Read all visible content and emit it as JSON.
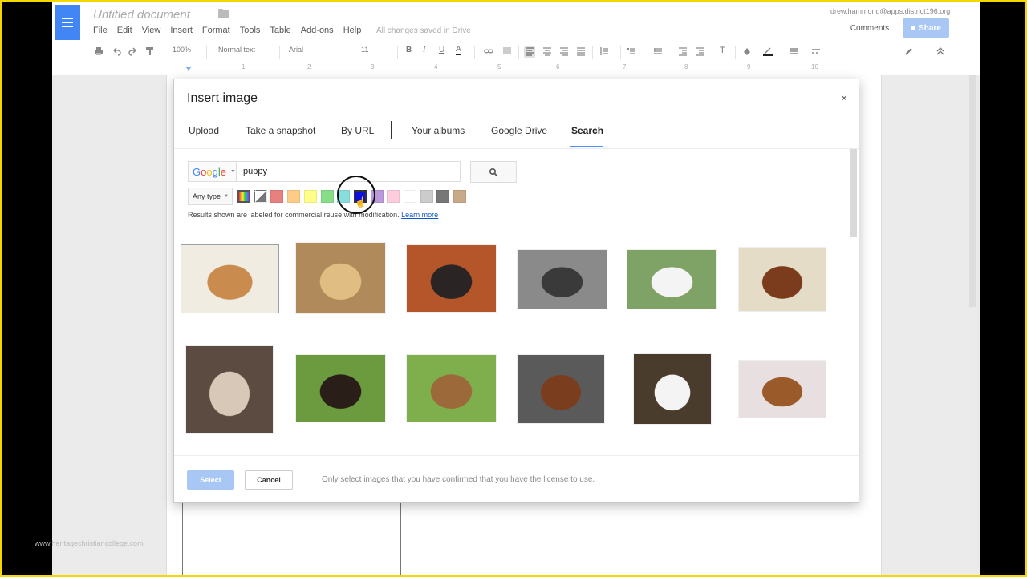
{
  "app": {
    "doc_title": "Untitled document",
    "user_email": "drew.hammond@apps.district196.org",
    "comments_label": "Comments",
    "share_label": "Share",
    "saved_status": "All changes saved in Drive"
  },
  "menu": [
    "File",
    "Edit",
    "View",
    "Insert",
    "Format",
    "Tools",
    "Table",
    "Add-ons",
    "Help"
  ],
  "toolbar": {
    "zoom": "100%",
    "style": "Normal text",
    "font": "Arial",
    "size": "11"
  },
  "ruler": [
    "1",
    "2",
    "3",
    "4",
    "5",
    "6",
    "7",
    "8",
    "9",
    "10"
  ],
  "dialog": {
    "title": "Insert image",
    "close": "×",
    "tabs": [
      "Upload",
      "Take a snapshot",
      "By URL",
      "Your albums",
      "Google Drive",
      "Search"
    ],
    "active_tab": "Search",
    "search_engine": "Google",
    "search_value": "puppy",
    "type_filter": "Any type",
    "swatch_colors": [
      "#f2f2f2",
      "#9e9e9e",
      "#e88080",
      "#ffcc88",
      "#ffff88",
      "#88dd88",
      "#88dddd",
      "#1010dd",
      "#bb99dd",
      "#ffccdd",
      "#ffffff",
      "#cccccc",
      "#777777",
      "#c8aa88"
    ],
    "license_text": "Results shown are labeled for commercial reuse with modification.",
    "learn_more": "Learn more",
    "images": [
      {
        "subject": "puppy-lying-on-blanket",
        "bg": "#f1ece2",
        "fg": "#c98b4e"
      },
      {
        "subject": "yellow-lab-puppy",
        "bg": "#b18a5c",
        "fg": "#e0bd82"
      },
      {
        "subject": "saint-bernard-puppy-in-leaves",
        "bg": "#b5552a",
        "fg": "#2b2424"
      },
      {
        "subject": "husky-puppy-on-pavement",
        "bg": "#8a8a8a",
        "fg": "#3a3a3a"
      },
      {
        "subject": "white-maltese-puppy",
        "bg": "#7fa267",
        "fg": "#f4f4f4"
      },
      {
        "subject": "boxer-puppy",
        "bg": "#e5dcc8",
        "fg": "#7a3c1c"
      },
      {
        "subject": "bulldog-puppy-in-sweater",
        "bg": "#5b4b40",
        "fg": "#d8c8b8"
      },
      {
        "subject": "rottweiler-puppy-on-grass",
        "bg": "#6c9a3e",
        "fg": "#2a1f18"
      },
      {
        "subject": "beagle-puppy-on-grass",
        "bg": "#7fae4c",
        "fg": "#9c6a3a"
      },
      {
        "subject": "border-collie-puppy",
        "bg": "#5a5a5a",
        "fg": "#7a3e1e"
      },
      {
        "subject": "white-samoyed-puppy",
        "bg": "#4a3c2c",
        "fg": "#f4f4f4"
      },
      {
        "subject": "brown-puppy-on-white",
        "bg": "#e8e0e0",
        "fg": "#9a5a2a"
      }
    ],
    "select_label": "Select",
    "cancel_label": "Cancel",
    "footer_note": "Only select images that you have confirmed that you have the license to use."
  },
  "watermark": "www.heritagechristiancollege.com"
}
